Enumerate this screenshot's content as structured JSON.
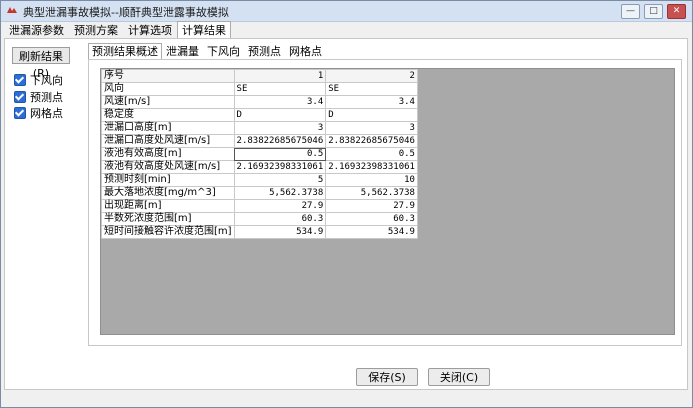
{
  "window": {
    "title": "典型泄漏事故模拟--顺酐典型泄露事故模拟",
    "buttons": {
      "minimize": "—",
      "maximize": "□",
      "close": "✕"
    }
  },
  "main_tabs": [
    "泄漏源参数",
    "预测方案",
    "计算选项",
    "计算结果"
  ],
  "sidebar": {
    "refresh_label": "刷新结果(R)",
    "checkboxes": [
      {
        "label": "下风向",
        "checked": true
      },
      {
        "label": "预测点",
        "checked": true
      },
      {
        "label": "网格点",
        "checked": true
      }
    ]
  },
  "sub_tabs": [
    "预测结果概述",
    "泄漏量",
    "下风向",
    "预测点",
    "网格点"
  ],
  "grid": {
    "columns": [
      "序号",
      "1",
      "2"
    ],
    "rows": [
      {
        "label": "风向",
        "v1": "SE",
        "v2": "SE",
        "text": true
      },
      {
        "label": "风速[m/s]",
        "v1": "3.4",
        "v2": "3.4"
      },
      {
        "label": "稳定度",
        "v1": "D",
        "v2": "D",
        "text": true
      },
      {
        "label": "泄漏口高度[m]",
        "v1": "3",
        "v2": "3"
      },
      {
        "label": "泄漏口高度处风速[m/s]",
        "v1": "2.83822685675046",
        "v2": "2.83822685675046"
      },
      {
        "label": "液池有效高度[m]",
        "v1": "0.5",
        "v2": "0.5"
      },
      {
        "label": "液池有效高度处风速[m/s]",
        "v1": "2.16932398331061",
        "v2": "2.16932398331061"
      },
      {
        "label": "预测时刻[min]",
        "v1": "5",
        "v2": "10"
      },
      {
        "label": "最大落地浓度[mg/m^3]",
        "v1": "5,562.3738",
        "v2": "5,562.3738"
      },
      {
        "label": "出现距离[m]",
        "v1": "27.9",
        "v2": "27.9"
      },
      {
        "label": "半数死浓度范围[m]",
        "v1": "60.3",
        "v2": "60.3"
      },
      {
        "label": "短时间接触容许浓度范围[m]",
        "v1": "534.9",
        "v2": "534.9"
      }
    ]
  },
  "footer": {
    "save_label": "保存(S)",
    "close_label": "关闭(C)"
  }
}
